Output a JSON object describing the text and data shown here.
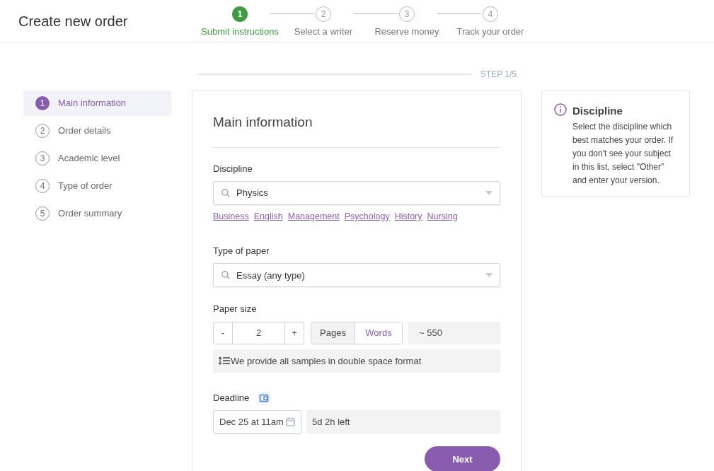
{
  "header": {
    "title": "Create new order"
  },
  "progress": [
    {
      "number": "1",
      "label": "Submit instructions",
      "selected": true
    },
    {
      "number": "2",
      "label": "Select a writer",
      "selected": false
    },
    {
      "number": "3",
      "label": "Reserve money",
      "selected": false
    },
    {
      "number": "4",
      "label": "Track your order",
      "selected": false
    }
  ],
  "step_counter": "STEP 1/5",
  "sidebar": {
    "items": [
      {
        "number": "1",
        "label": "Main information",
        "selected": true
      },
      {
        "number": "2",
        "label": "Order details",
        "selected": false
      },
      {
        "number": "3",
        "label": "Academic level",
        "selected": false
      },
      {
        "number": "4",
        "label": "Type of order",
        "selected": false
      },
      {
        "number": "5",
        "label": "Order summary",
        "selected": false
      }
    ]
  },
  "form": {
    "title": "Main information",
    "discipline": {
      "label": "Discipline",
      "value": "Physics",
      "suggestions": [
        "Business",
        "English",
        "Management",
        "Psychology",
        "History",
        "Nursing"
      ]
    },
    "paper_type": {
      "label": "Type of paper",
      "value": "Essay (any type)"
    },
    "paper_size": {
      "label": "Paper size",
      "decrement": "-",
      "value": "2",
      "increment": "+",
      "units": [
        {
          "label": "Pages",
          "selected": true
        },
        {
          "label": "Words",
          "selected": false
        }
      ],
      "word_count": "~ 550",
      "note": "We provide all samples in double space format"
    },
    "deadline": {
      "label": "Deadline",
      "date": "Dec 25 at 11am",
      "time_left": "5d 2h left"
    },
    "next_button": "Next"
  },
  "info": {
    "title": "Discipline",
    "text": "Select the discipline which best matches your order. If you don't see your subject in this list, select \"Other\" and enter your version."
  }
}
